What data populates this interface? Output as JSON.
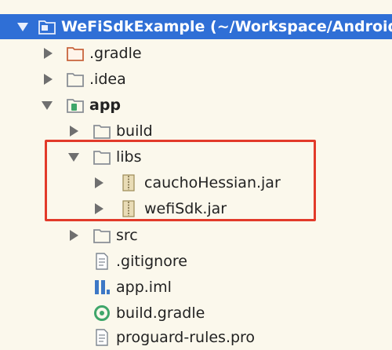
{
  "project_tree": {
    "root": {
      "label": "WeFiSdkExample (~/Workspace/Android/",
      "expanded": true
    },
    "items": [
      {
        "label": ".gradle",
        "icon": "folder-icon",
        "state": "collapsed"
      },
      {
        "label": ".idea",
        "icon": "folder-icon",
        "state": "collapsed"
      },
      {
        "label": "app",
        "icon": "module-folder-icon",
        "state": "expanded"
      },
      {
        "label": "build",
        "icon": "folder-icon",
        "state": "collapsed"
      },
      {
        "label": "libs",
        "icon": "folder-icon",
        "state": "expanded"
      },
      {
        "label": "cauchoHessian.jar",
        "icon": "jar-icon",
        "state": "collapsed"
      },
      {
        "label": "wefiSdk.jar",
        "icon": "jar-icon",
        "state": "collapsed"
      },
      {
        "label": "src",
        "icon": "folder-icon",
        "state": "collapsed"
      },
      {
        "label": ".gitignore",
        "icon": "text-file-icon",
        "state": "leaf"
      },
      {
        "label": "app.iml",
        "icon": "iml-file-icon",
        "state": "leaf"
      },
      {
        "label": "build.gradle",
        "icon": "gradle-file-icon",
        "state": "leaf"
      },
      {
        "label": "proguard-rules.pro",
        "icon": "text-file-icon",
        "state": "leaf"
      }
    ]
  },
  "colors": {
    "selection": "#2f6fd6",
    "highlight_border": "#e23a2a",
    "background": "#fbf8ec",
    "folder_orange": "#c8643c",
    "folder_gray": "#8a8f96",
    "gradle_green": "#3fa66a",
    "iml_blue": "#3d78c6"
  }
}
